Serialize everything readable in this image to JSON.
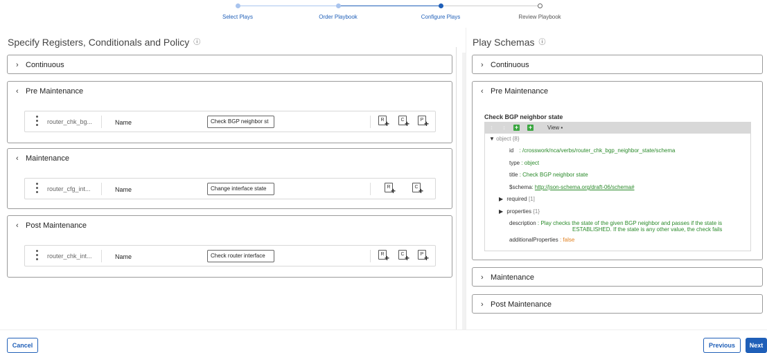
{
  "stepper": {
    "steps": [
      {
        "label": "Select Plays",
        "state": "done"
      },
      {
        "label": "Order Playbook",
        "state": "done"
      },
      {
        "label": "Configure Plays",
        "state": "active"
      },
      {
        "label": "Review Playbook",
        "state": "todo"
      }
    ],
    "colors": {
      "done": "#a9c4ee",
      "active": "#1f5fb8",
      "todo": "#888888"
    }
  },
  "left": {
    "title": "Specify Registers, Conditionals and Policy",
    "info_icon": "info-circle-icon",
    "sections": [
      {
        "label": "Continuous",
        "expanded": false
      },
      {
        "label": "Pre Maintenance",
        "expanded": true,
        "play": {
          "id": "router_chk_bg...",
          "name_label": "Name",
          "name_value": "Check BGP neighbor st",
          "buttons": [
            "R",
            "C",
            "P"
          ]
        }
      },
      {
        "label": "Maintenance",
        "expanded": true,
        "play": {
          "id": "router_cfg_int...",
          "name_label": "Name",
          "name_value": "Change interface state",
          "buttons": [
            "R",
            "C"
          ]
        }
      },
      {
        "label": "Post Maintenance",
        "expanded": true,
        "play": {
          "id": "router_chk_int...",
          "name_label": "Name",
          "name_value": "Check router interface",
          "buttons": [
            "R",
            "C",
            "P"
          ]
        }
      }
    ]
  },
  "right": {
    "title": "Play Schemas",
    "info_icon": "info-circle-icon",
    "sections": [
      {
        "label": "Continuous",
        "expanded": false
      },
      {
        "label": "Pre Maintenance",
        "expanded": true
      },
      {
        "label": "Maintenance",
        "expanded": false
      },
      {
        "label": "Post Maintenance",
        "expanded": false
      }
    ],
    "schema": {
      "heading": "Check BGP neighbor state",
      "toolbar_view": "View ▪",
      "root": "object",
      "root_count": "{8}",
      "id_key": "id",
      "id_value": ": /crosswork/nca/verbs/router_chk_bgp_neighbor_state/schema",
      "type_key": "type",
      "type_value": ": object",
      "title_key": "title",
      "title_value": ": Check BGP neighbor state",
      "schema_key": "$schema",
      "schema_sep": ": ",
      "schema_value": "http://json-schema.org/draft-06/schema#",
      "required_key": "required",
      "required_count": "[1]",
      "properties_key": "properties",
      "properties_count": "{1}",
      "description_key": "description",
      "description_value_1": ": Play checks the state of the given BGP neighbor and passes if the state is",
      "description_value_2": "ESTABLISHED. If the state is any other value, the check fails",
      "addprops_key": "additionalProperties",
      "addprops_value": ": false"
    }
  },
  "footer": {
    "cancel": "Cancel",
    "previous": "Previous",
    "next": "Next"
  }
}
